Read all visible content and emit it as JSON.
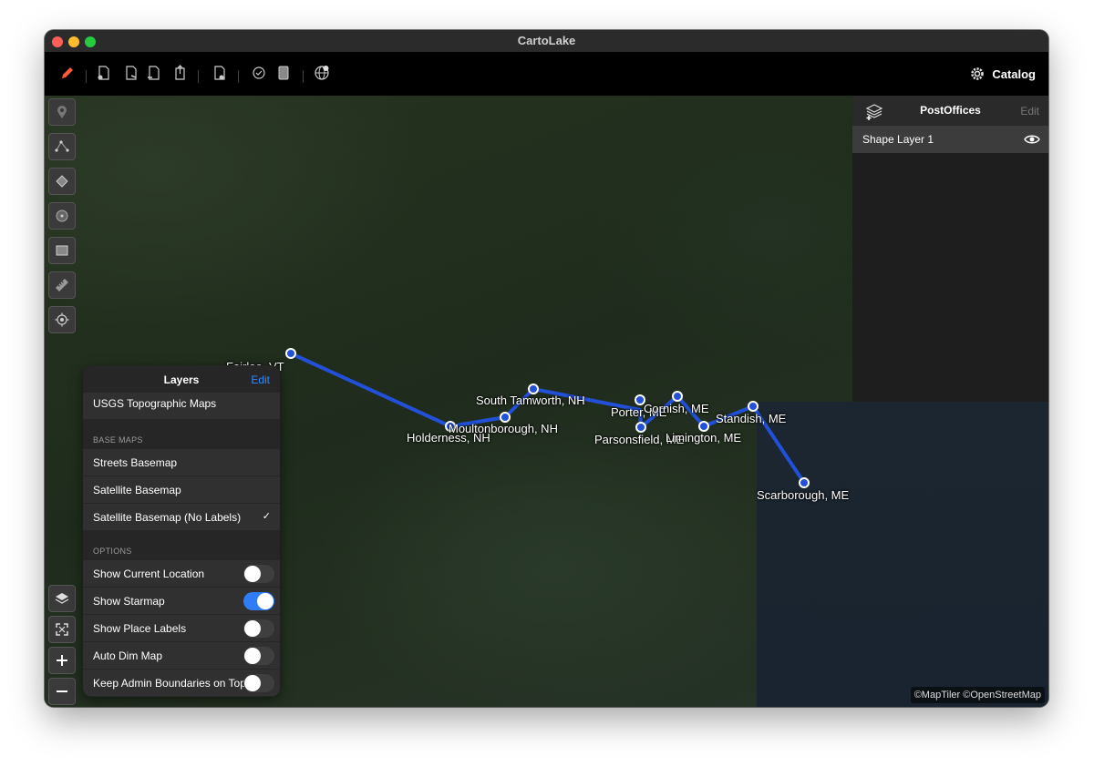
{
  "window": {
    "title": "CartoLake"
  },
  "toolbar": {
    "tools": [
      "pencil-icon",
      "add-point-icon",
      "add-line-icon",
      "add-polygon-icon",
      "export-icon",
      "attach-icon",
      "refresh-icon",
      "device-icon",
      "globe-icon"
    ],
    "catalog_label": "Catalog"
  },
  "map": {
    "places": [
      {
        "name": "Fairlee, VT"
      },
      {
        "name": "Holderness, NH"
      },
      {
        "name": "Moultonborough, NH"
      },
      {
        "name": "South Tamworth, NH"
      },
      {
        "name": "Porter, ME"
      },
      {
        "name": "Cornish, ME"
      },
      {
        "name": "Parsonsfield, ME"
      },
      {
        "name": "Limington, ME"
      },
      {
        "name": "Standish, ME"
      },
      {
        "name": "Scarborough, ME"
      }
    ],
    "attribution": "©MapTiler  ©OpenStreetMap"
  },
  "right_panel": {
    "title": "PostOffices",
    "edit_label": "Edit",
    "layers": [
      {
        "name": "Shape Layer 1"
      }
    ]
  },
  "layers_panel": {
    "title": "Layers",
    "edit_label": "Edit",
    "top_item": "USGS Topographic Maps",
    "base_maps_header": "BASE MAPS",
    "base_maps": [
      {
        "label": "Streets Basemap",
        "selected": false
      },
      {
        "label": "Satellite Basemap",
        "selected": false
      },
      {
        "label": "Satellite Basemap (No Labels)",
        "selected": true
      }
    ],
    "check_mark": "✓",
    "options_header": "OPTIONS",
    "options": [
      {
        "label": "Show Current Location",
        "on": false
      },
      {
        "label": "Show Starmap",
        "on": true
      },
      {
        "label": "Show Place Labels",
        "on": false
      },
      {
        "label": "Auto Dim Map",
        "on": false
      },
      {
        "label": "Keep Admin Boundaries on Top",
        "on": false
      }
    ]
  },
  "colors": {
    "route": "#2350d8",
    "accent": "#2f7df6"
  }
}
